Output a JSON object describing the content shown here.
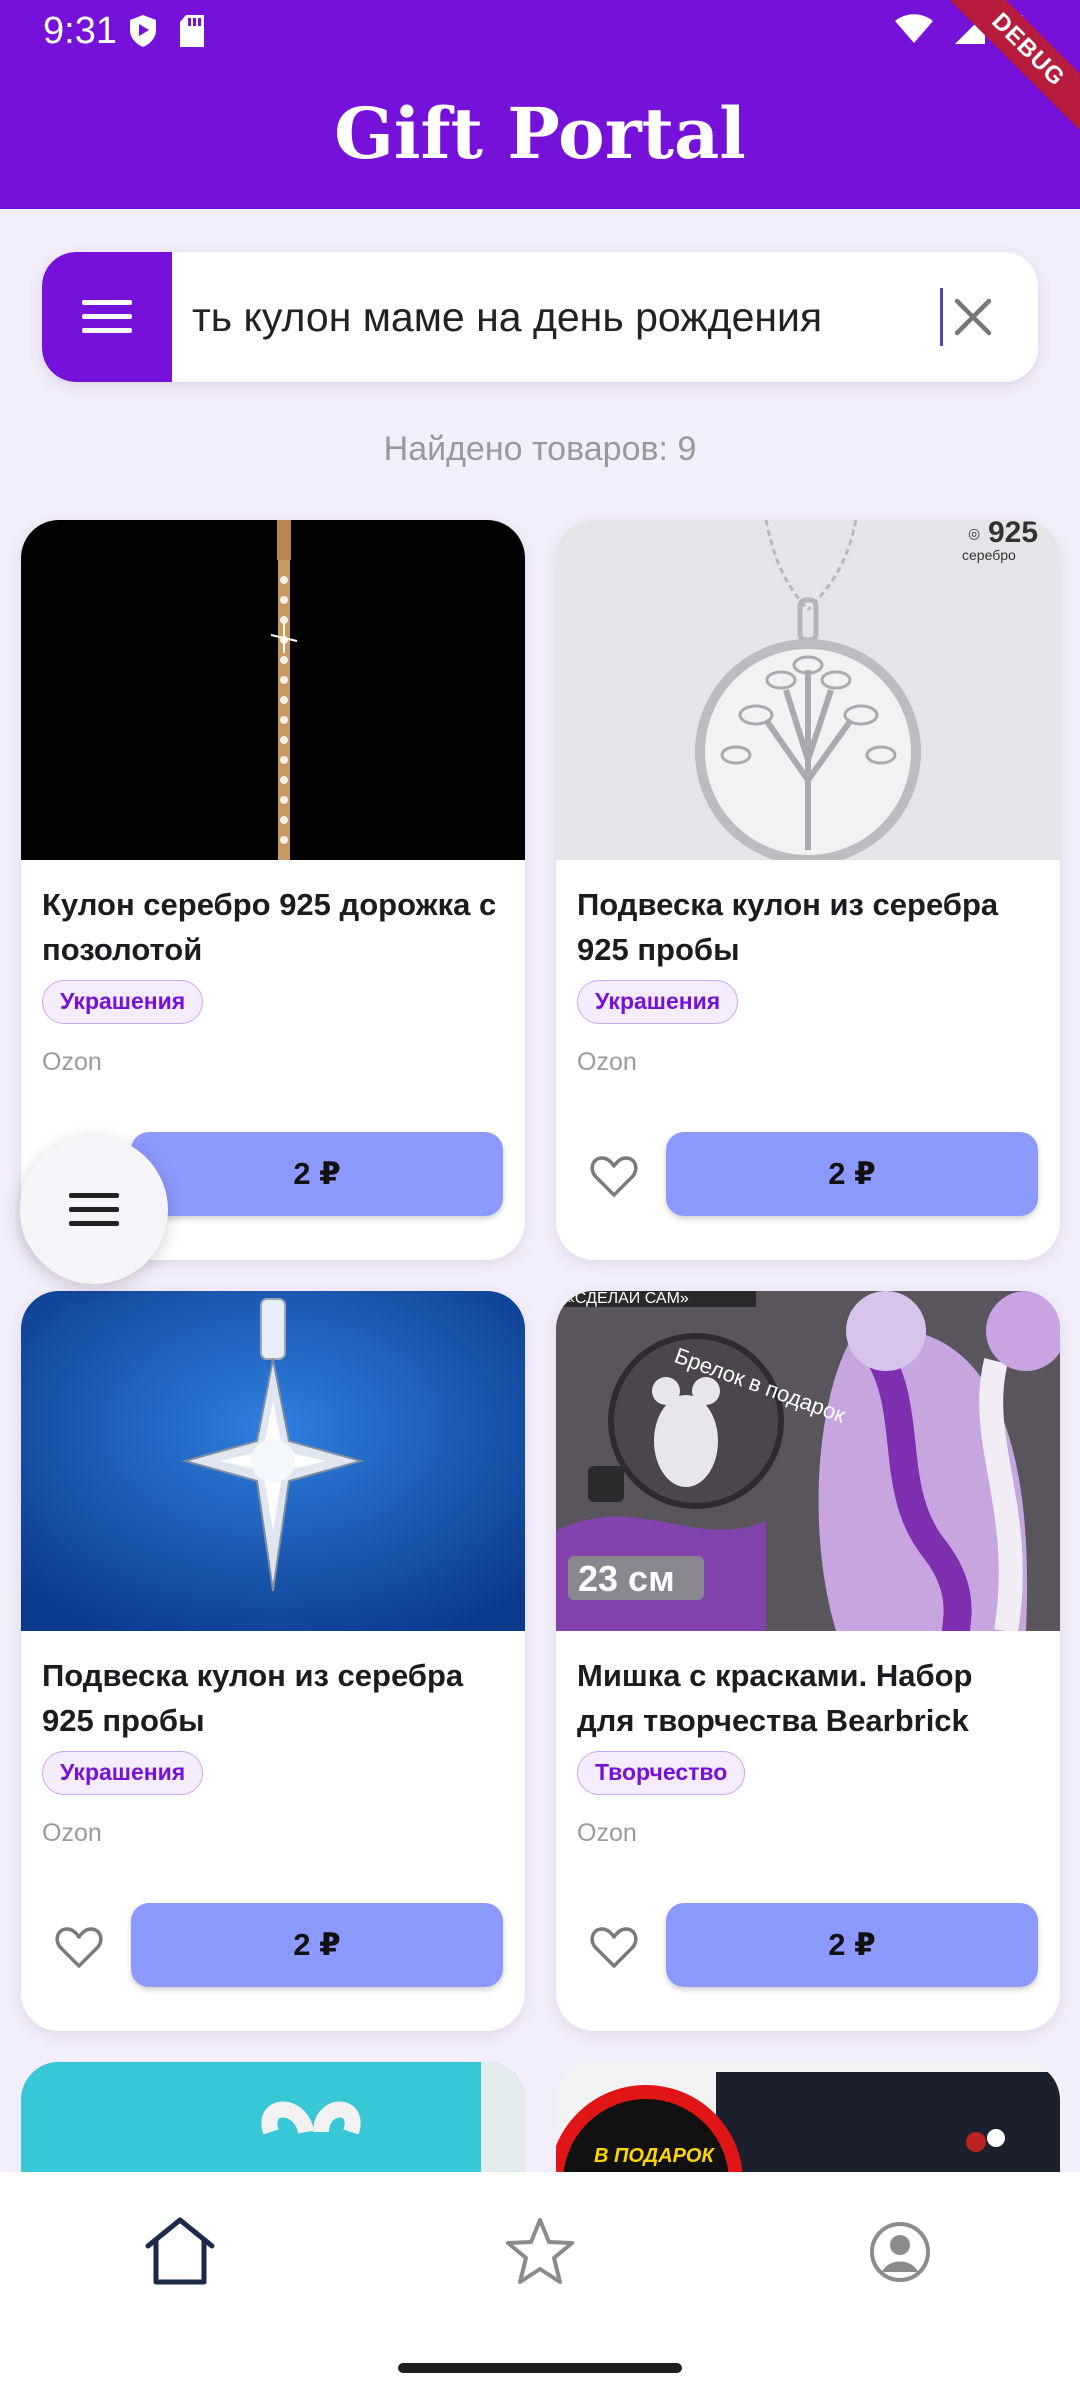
{
  "status_bar": {
    "time": "9:31",
    "debug_label": "DEBUG"
  },
  "header": {
    "title": "Gift Portal"
  },
  "search": {
    "query": "ть кулон маме на день рождения"
  },
  "results": {
    "count_text": "Найдено товаров: 9"
  },
  "products": [
    {
      "title": "Кулон серебро 925 дорожка с позолотой",
      "tag": "Украшения",
      "store": "Ozon",
      "price": "2 ₽"
    },
    {
      "title": "Подвеска кулон из серебра 925 пробы",
      "tag": "Украшения",
      "store": "Ozon",
      "price": "2 ₽",
      "image_text": "925\nсеребро"
    },
    {
      "title": "Подвеска кулон из серебра 925 пробы",
      "tag": "Украшения",
      "store": "Ozon",
      "price": "2 ₽"
    },
    {
      "title": "Мишка с красками. Набор для творчества Bearbrick",
      "tag": "Творчество",
      "store": "Ozon",
      "price": "2 ₽",
      "image_text": {
        "top": "«СДЕЛАЙ САМ»",
        "badge": "Брелок в подарок",
        "size": "23 см"
      }
    }
  ],
  "partial_cards": [
    {
      "image_text": ""
    },
    {
      "image_text": "В ПОДАРОК СЕРТИФИКАТ"
    }
  ],
  "nav": {
    "items": [
      "home-icon",
      "star-icon",
      "profile-icon"
    ],
    "active": "home-icon"
  },
  "colors": {
    "primary": "#7511d9",
    "price_button": "#8c9aff",
    "background": "#f3eefb"
  }
}
